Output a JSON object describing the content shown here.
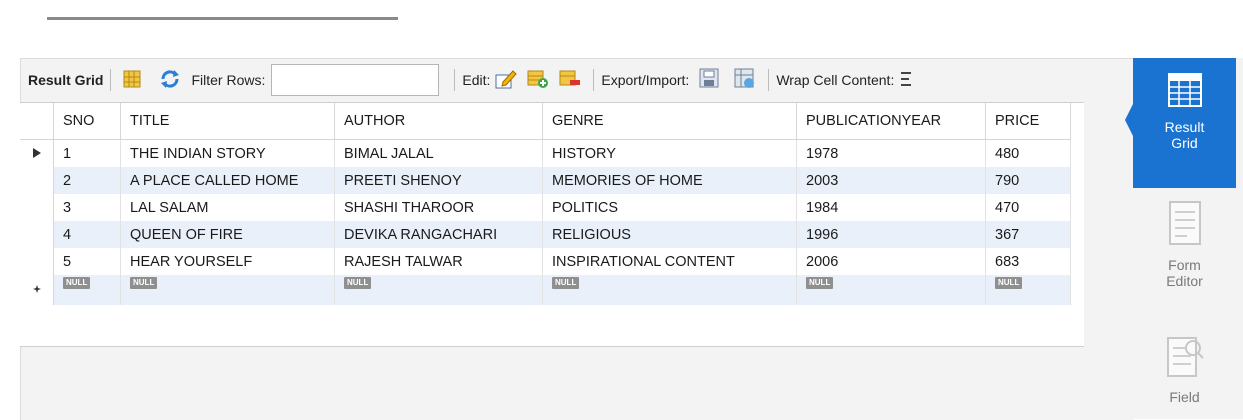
{
  "toolbar": {
    "result_grid": "Result Grid",
    "filter_label": "Filter Rows:",
    "filter_value": "",
    "edit_label": "Edit:",
    "export_label": "Export/Import:",
    "wrap_label": "Wrap Cell Content:"
  },
  "grid": {
    "columns": [
      "SNO",
      "TITLE",
      "AUTHOR",
      "GENRE",
      "PUBLICATIONYEAR",
      "PRICE"
    ],
    "rows": [
      [
        "1",
        "THE INDIAN STORY",
        "BIMAL JALAL",
        "HISTORY",
        "1978",
        "480"
      ],
      [
        "2",
        "A PLACE CALLED HOME",
        "PREETI SHENOY",
        "MEMORIES OF HOME",
        "2003",
        "790"
      ],
      [
        "3",
        "LAL SALAM",
        "SHASHI THAROOR",
        "POLITICS",
        "1984",
        "470"
      ],
      [
        "4",
        "QUEEN OF FIRE",
        "DEVIKA RANGACHARI",
        "RELIGIOUS",
        "1996",
        "367"
      ],
      [
        "5",
        "HEAR YOURSELF",
        "RAJESH TALWAR",
        "INSPIRATIONAL CONTENT",
        "2006",
        "683"
      ]
    ],
    "null_text": "NULL"
  },
  "sidebar": {
    "result_grid_l1": "Result",
    "result_grid_l2": "Grid",
    "form_editor_l1": "Form",
    "form_editor_l2": "Editor",
    "field_l1": "Field"
  },
  "colors": {
    "accent": "#1b73d1",
    "alt_row": "#e9f0fa",
    "null_badge": "#8f8f8f"
  }
}
